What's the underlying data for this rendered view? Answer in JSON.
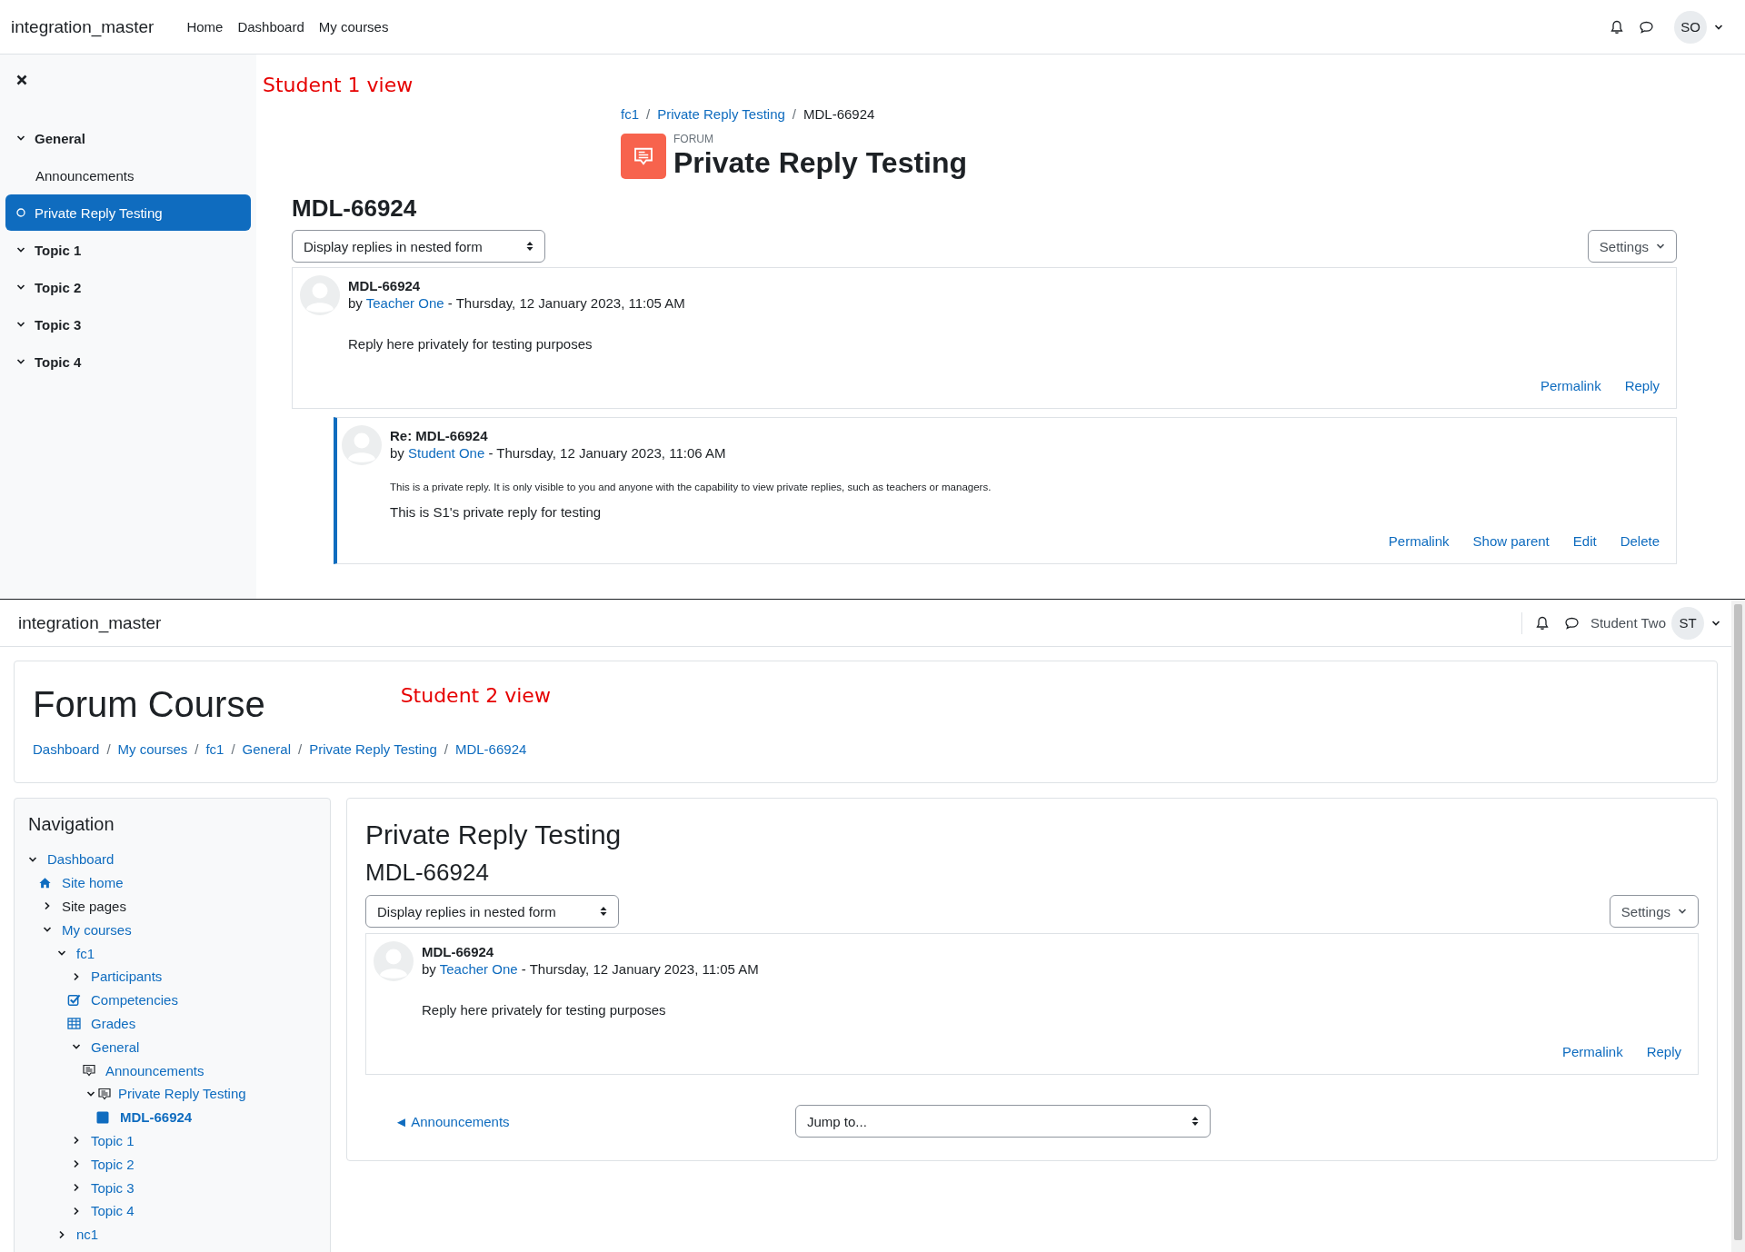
{
  "student1_view": {
    "navbar": {
      "site_name": "integration_master",
      "links": [
        "Home",
        "Dashboard",
        "My courses"
      ],
      "avatar_initials": "SO"
    },
    "drawer": {
      "items": [
        {
          "label": "General",
          "kind": "section",
          "expanded": true
        },
        {
          "label": "Announcements",
          "kind": "activity",
          "selected": false
        },
        {
          "label": "Private Reply Testing",
          "kind": "activity",
          "selected": true
        },
        {
          "label": "Topic 1",
          "kind": "section",
          "expanded": true
        },
        {
          "label": "Topic 2",
          "kind": "section",
          "expanded": true
        },
        {
          "label": "Topic 3",
          "kind": "section",
          "expanded": true
        },
        {
          "label": "Topic 4",
          "kind": "section",
          "expanded": true
        }
      ]
    },
    "annotation": "Student 1 view",
    "breadcrumb_separator": "/",
    "breadcrumb": [
      {
        "label": "fc1",
        "current": false
      },
      {
        "label": "Private Reply Testing",
        "current": false
      },
      {
        "label": "MDL-66924",
        "current": true
      }
    ],
    "activity_type": "FORUM",
    "title": "Private Reply Testing",
    "discussion_title": "MDL-66924",
    "display_mode": "Display replies in nested form",
    "settings": "Settings",
    "posts": [
      {
        "subject": "MDL-66924",
        "byline": {
          "prefix": "by",
          "author": "Teacher One",
          "suffix": "- Thursday, 12 January 2023, 11:05 AM"
        },
        "message": "Reply here privately for testing purposes",
        "actions": [
          "Permalink",
          "Reply"
        ],
        "replies": [
          {
            "subject": "Re: MDL-66924",
            "byline": {
              "prefix": "by",
              "author": "Student One",
              "suffix": "- Thursday, 12 January 2023, 11:06 AM"
            },
            "private_note": "This is a private reply. It is only visible to you and anyone with the capability to view private replies, such as teachers or managers.",
            "message": "This is S1's private reply for testing",
            "actions": [
              "Permalink",
              "Show parent",
              "Edit",
              "Delete"
            ]
          }
        ]
      }
    ]
  },
  "student2_view": {
    "navbar": {
      "site_name": "integration_master",
      "user_name": "Student Two",
      "avatar_initials": "ST"
    },
    "course_title": "Forum Course",
    "annotation": "Student 2 view",
    "breadcrumb_separator": "/",
    "breadcrumb": [
      {
        "label": "Dashboard",
        "current": false
      },
      {
        "label": "My courses",
        "current": false
      },
      {
        "label": "fc1",
        "current": false
      },
      {
        "label": "General",
        "current": false
      },
      {
        "label": "Private Reply Testing",
        "current": false
      },
      {
        "label": "MDL-66924",
        "current": false
      }
    ],
    "navigation": {
      "title": "Navigation",
      "tree": [
        {
          "label": "Dashboard",
          "expanded": true,
          "children": [
            {
              "label": "Site home",
              "kind": "home"
            },
            {
              "label": "Site pages",
              "kind": "category",
              "expanded": false
            },
            {
              "label": "My courses",
              "expanded": true,
              "children": [
                {
                  "label": "fc1",
                  "expanded": true,
                  "children": [
                    {
                      "label": "Participants",
                      "expanded": false
                    },
                    {
                      "label": "Competencies",
                      "kind": "competencies"
                    },
                    {
                      "label": "Grades",
                      "kind": "grades"
                    },
                    {
                      "label": "General",
                      "expanded": true,
                      "children": [
                        {
                          "label": "Announcements",
                          "kind": "forum"
                        },
                        {
                          "label": "Private Reply Testing",
                          "kind": "forum",
                          "expanded": true,
                          "children": [
                            {
                              "label": "MDL-66924",
                              "kind": "current"
                            }
                          ]
                        }
                      ]
                    },
                    {
                      "label": "Topic 1",
                      "expanded": false
                    },
                    {
                      "label": "Topic 2",
                      "expanded": false
                    },
                    {
                      "label": "Topic 3",
                      "expanded": false
                    },
                    {
                      "label": "Topic 4",
                      "expanded": false
                    }
                  ]
                },
                {
                  "label": "nc1",
                  "expanded": false
                }
              ]
            }
          ]
        }
      ]
    },
    "forum_title": "Private Reply Testing",
    "discussion_title": "MDL-66924",
    "display_mode": "Display replies in nested form",
    "settings": "Settings",
    "posts": [
      {
        "subject": "MDL-66924",
        "byline": {
          "prefix": "by",
          "author": "Teacher One",
          "suffix": "- Thursday, 12 January 2023, 11:05 AM"
        },
        "message": "Reply here privately for testing purposes",
        "actions": [
          "Permalink",
          "Reply"
        ]
      }
    ],
    "previous_link": "◄ Announcements",
    "jump_to": "Jump to..."
  }
}
